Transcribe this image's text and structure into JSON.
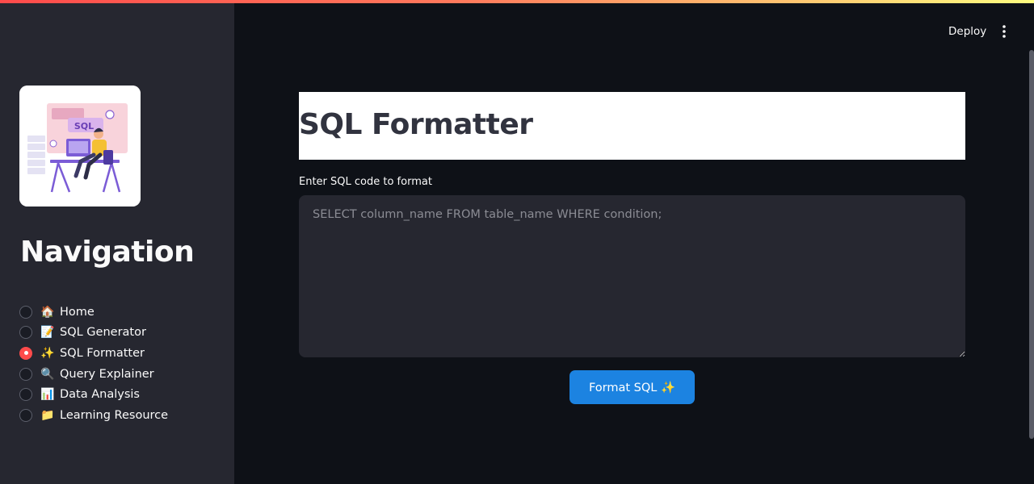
{
  "sidebar": {
    "title": "Navigation",
    "items": [
      {
        "emoji": "🏠",
        "label": "Home",
        "selected": false
      },
      {
        "emoji": "📝",
        "label": "SQL Generator",
        "selected": false
      },
      {
        "emoji": "✨",
        "label": "SQL Formatter",
        "selected": true
      },
      {
        "emoji": "🔍",
        "label": "Query Explainer",
        "selected": false
      },
      {
        "emoji": "📊",
        "label": "Data Analysis",
        "selected": false
      },
      {
        "emoji": "📁",
        "label": "Learning Resource",
        "selected": false
      }
    ],
    "logo_text": "SQL"
  },
  "header": {
    "deploy_label": "Deploy"
  },
  "main": {
    "title": "SQL Formatter",
    "input_label": "Enter SQL code to format",
    "input_placeholder": "SELECT column_name FROM table_name WHERE condition;",
    "input_value": "",
    "button_label": "Format SQL ✨"
  },
  "colors": {
    "accent": "#ff4b4b",
    "primary_button": "#1c83e1",
    "background": "#0e1117",
    "sidebar": "#262730"
  }
}
